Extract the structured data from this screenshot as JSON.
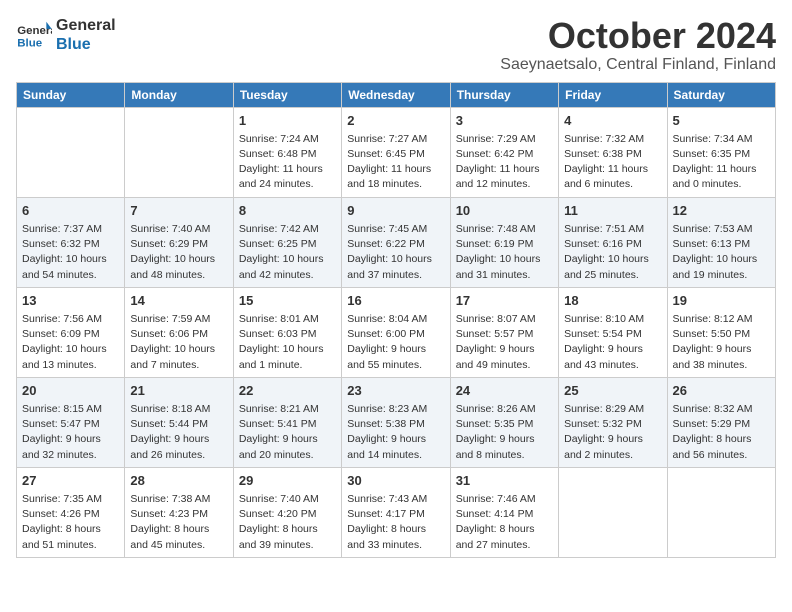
{
  "logo": {
    "name": "General",
    "name2": "Blue"
  },
  "title": "October 2024",
  "subtitle": "Saeynaetsalo, Central Finland, Finland",
  "weekdays": [
    "Sunday",
    "Monday",
    "Tuesday",
    "Wednesday",
    "Thursday",
    "Friday",
    "Saturday"
  ],
  "weeks": [
    [
      {
        "day": null
      },
      {
        "day": null
      },
      {
        "day": "1",
        "sunrise": "7:24 AM",
        "sunset": "6:48 PM",
        "daylight": "11 hours and 24 minutes."
      },
      {
        "day": "2",
        "sunrise": "7:27 AM",
        "sunset": "6:45 PM",
        "daylight": "11 hours and 18 minutes."
      },
      {
        "day": "3",
        "sunrise": "7:29 AM",
        "sunset": "6:42 PM",
        "daylight": "11 hours and 12 minutes."
      },
      {
        "day": "4",
        "sunrise": "7:32 AM",
        "sunset": "6:38 PM",
        "daylight": "11 hours and 6 minutes."
      },
      {
        "day": "5",
        "sunrise": "7:34 AM",
        "sunset": "6:35 PM",
        "daylight": "11 hours and 0 minutes."
      }
    ],
    [
      {
        "day": "6",
        "sunrise": "7:37 AM",
        "sunset": "6:32 PM",
        "daylight": "10 hours and 54 minutes."
      },
      {
        "day": "7",
        "sunrise": "7:40 AM",
        "sunset": "6:29 PM",
        "daylight": "10 hours and 48 minutes."
      },
      {
        "day": "8",
        "sunrise": "7:42 AM",
        "sunset": "6:25 PM",
        "daylight": "10 hours and 42 minutes."
      },
      {
        "day": "9",
        "sunrise": "7:45 AM",
        "sunset": "6:22 PM",
        "daylight": "10 hours and 37 minutes."
      },
      {
        "day": "10",
        "sunrise": "7:48 AM",
        "sunset": "6:19 PM",
        "daylight": "10 hours and 31 minutes."
      },
      {
        "day": "11",
        "sunrise": "7:51 AM",
        "sunset": "6:16 PM",
        "daylight": "10 hours and 25 minutes."
      },
      {
        "day": "12",
        "sunrise": "7:53 AM",
        "sunset": "6:13 PM",
        "daylight": "10 hours and 19 minutes."
      }
    ],
    [
      {
        "day": "13",
        "sunrise": "7:56 AM",
        "sunset": "6:09 PM",
        "daylight": "10 hours and 13 minutes."
      },
      {
        "day": "14",
        "sunrise": "7:59 AM",
        "sunset": "6:06 PM",
        "daylight": "10 hours and 7 minutes."
      },
      {
        "day": "15",
        "sunrise": "8:01 AM",
        "sunset": "6:03 PM",
        "daylight": "10 hours and 1 minute."
      },
      {
        "day": "16",
        "sunrise": "8:04 AM",
        "sunset": "6:00 PM",
        "daylight": "9 hours and 55 minutes."
      },
      {
        "day": "17",
        "sunrise": "8:07 AM",
        "sunset": "5:57 PM",
        "daylight": "9 hours and 49 minutes."
      },
      {
        "day": "18",
        "sunrise": "8:10 AM",
        "sunset": "5:54 PM",
        "daylight": "9 hours and 43 minutes."
      },
      {
        "day": "19",
        "sunrise": "8:12 AM",
        "sunset": "5:50 PM",
        "daylight": "9 hours and 38 minutes."
      }
    ],
    [
      {
        "day": "20",
        "sunrise": "8:15 AM",
        "sunset": "5:47 PM",
        "daylight": "9 hours and 32 minutes."
      },
      {
        "day": "21",
        "sunrise": "8:18 AM",
        "sunset": "5:44 PM",
        "daylight": "9 hours and 26 minutes."
      },
      {
        "day": "22",
        "sunrise": "8:21 AM",
        "sunset": "5:41 PM",
        "daylight": "9 hours and 20 minutes."
      },
      {
        "day": "23",
        "sunrise": "8:23 AM",
        "sunset": "5:38 PM",
        "daylight": "9 hours and 14 minutes."
      },
      {
        "day": "24",
        "sunrise": "8:26 AM",
        "sunset": "5:35 PM",
        "daylight": "9 hours and 8 minutes."
      },
      {
        "day": "25",
        "sunrise": "8:29 AM",
        "sunset": "5:32 PM",
        "daylight": "9 hours and 2 minutes."
      },
      {
        "day": "26",
        "sunrise": "8:32 AM",
        "sunset": "5:29 PM",
        "daylight": "8 hours and 56 minutes."
      }
    ],
    [
      {
        "day": "27",
        "sunrise": "7:35 AM",
        "sunset": "4:26 PM",
        "daylight": "8 hours and 51 minutes."
      },
      {
        "day": "28",
        "sunrise": "7:38 AM",
        "sunset": "4:23 PM",
        "daylight": "8 hours and 45 minutes."
      },
      {
        "day": "29",
        "sunrise": "7:40 AM",
        "sunset": "4:20 PM",
        "daylight": "8 hours and 39 minutes."
      },
      {
        "day": "30",
        "sunrise": "7:43 AM",
        "sunset": "4:17 PM",
        "daylight": "8 hours and 33 minutes."
      },
      {
        "day": "31",
        "sunrise": "7:46 AM",
        "sunset": "4:14 PM",
        "daylight": "8 hours and 27 minutes."
      },
      {
        "day": null
      },
      {
        "day": null
      }
    ]
  ]
}
